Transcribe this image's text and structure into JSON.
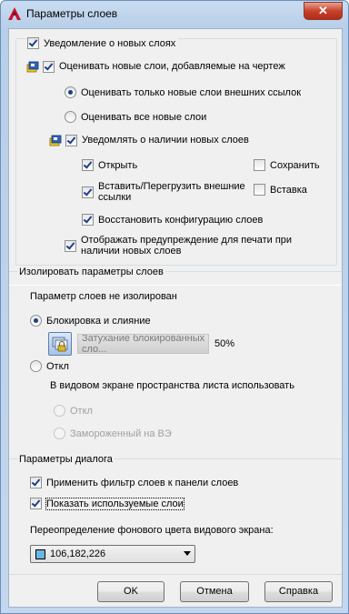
{
  "window": {
    "title": "Параметры слоев",
    "close_glyph": "✕"
  },
  "notify": {
    "legend": "Уведомление о новых слоях",
    "evaluate_new": "Оценивать новые слои, добавляемые на чертеж",
    "only_xref": "Оценивать только новые слои внешних ссылок",
    "all_new": "Оценивать все новые слои",
    "notify_present": "Уведомлять о наличии новых слоев",
    "open": "Открыть",
    "save": "Сохранить",
    "attach_reload": "Вставить/Перегрузить внешние ссылки",
    "insert": "Вставка",
    "restore": "Восстановить конфигурацию слоев",
    "plot_warning": "Отображать предупреждение для печати при наличии новых слоев"
  },
  "isolate": {
    "legend": "Изолировать параметры слоев",
    "status": "Параметр слоев не изолирован",
    "lock_fade": "Блокировка и слияние",
    "fade_label": "Затухание блокированных сло...",
    "fade_value": "50%",
    "off": "Откл",
    "viewport_label": "В видовом экране пространства листа использовать",
    "vp_off": "Откл",
    "vp_frozen": "Замороженный на ВЭ"
  },
  "dialog": {
    "legend": "Параметры диалога",
    "apply_filter": "Применить фильтр слоев к панели слоев",
    "show_used": "Показать используемые слои",
    "bg_override_label": "Переопределение фонового цвета видового экрана:",
    "bg_color_value": "106,182,226",
    "bg_color_hex": "#6ab6e2"
  },
  "buttons": {
    "ok": "OK",
    "cancel": "Отмена",
    "help": "Справка"
  },
  "state": {
    "notify_checked": true,
    "evaluate_checked": true,
    "only_xref_selected": true,
    "notify_present_checked": true,
    "open_checked": true,
    "save_checked": false,
    "attach_checked": true,
    "insert_checked": false,
    "restore_checked": true,
    "plot_checked": true,
    "lock_fade_selected": true,
    "apply_filter_checked": true,
    "show_used_checked": true
  },
  "icons": {
    "app": "autocad-a-icon",
    "layer_state": "layer-notify-icon",
    "fade": "lock-fade-icon"
  }
}
